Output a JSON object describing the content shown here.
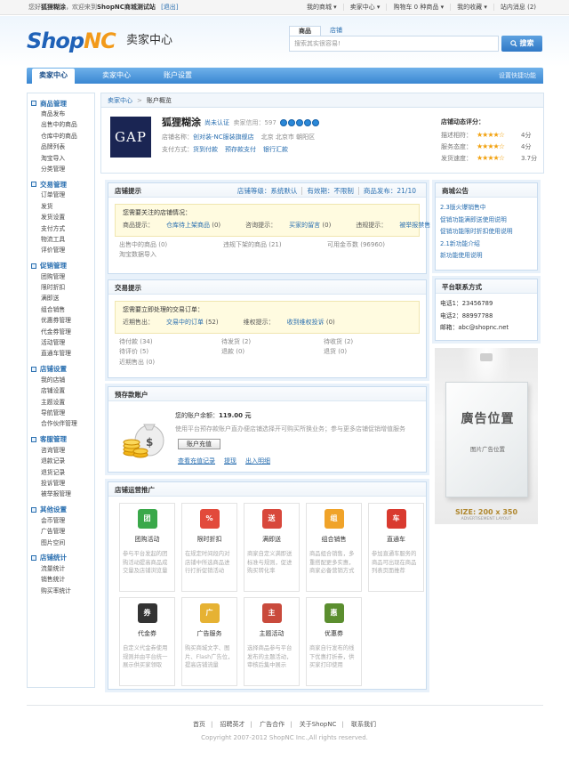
{
  "topbar": {
    "welcome_prefix": "您好",
    "user": "狐狸糊涂",
    "welcome_mid": "，欢迎来到",
    "site": "ShopNC商城测试站",
    "logout": "[退出]",
    "nav": [
      "我的商城 ▾",
      "卖家中心 ▾",
      "购物车 0 种商品 ▾",
      "我的收藏 ▾",
      "站内消息 (2)"
    ]
  },
  "header": {
    "logo_a": "Shop",
    "logo_b": "NC",
    "title": "卖家中心",
    "search_tabs": [
      "商品",
      "店铺"
    ],
    "search_placeholder": "搜索其实很容易!",
    "search_button": "搜索"
  },
  "mainnav": {
    "items": [
      "卖家中心",
      "卖家中心",
      "账户设置"
    ],
    "quick": "设置快捷功能"
  },
  "sidebar": [
    {
      "title": "商品管理",
      "items": [
        "商品发布",
        "出售中的商品",
        "仓库中的商品",
        "品牌列表",
        "淘宝导入",
        "分类管理"
      ]
    },
    {
      "title": "交易管理",
      "items": [
        "订单管理",
        "发货",
        "发货设置",
        "支付方式",
        "物流工具",
        "评价管理"
      ]
    },
    {
      "title": "促销管理",
      "items": [
        "团购管理",
        "限时折扣",
        "满即送",
        "组合销售",
        "优惠券管理",
        "代金券管理",
        "活动管理",
        "直通车管理"
      ]
    },
    {
      "title": "店铺设置",
      "items": [
        "我的店铺",
        "店铺设置",
        "主题设置",
        "导航管理",
        "合作伙伴管理"
      ]
    },
    {
      "title": "客服管理",
      "items": [
        "咨询管理",
        "退款记录",
        "退货记录",
        "投诉管理",
        "被举报管理"
      ]
    },
    {
      "title": "其他设置",
      "items": [
        "会币管理",
        "广告管理",
        "图片空间"
      ]
    },
    {
      "title": "店铺统计",
      "items": [
        "流量统计",
        "销售统计",
        "购买率统计"
      ]
    }
  ],
  "breadcrumb": {
    "root": "卖家中心",
    "sep": ">",
    "current": "账户概览"
  },
  "shop": {
    "logo": "GAP",
    "name": "狐狸糊涂",
    "cert": "尚未认证",
    "credit": "卖家信用：597",
    "line1_label": "店铺名称：",
    "line1_link": "创对装-NC服装旗舰店",
    "line1_loc": "北京 北京市 朝阳区",
    "line2_label": "支付方式：",
    "pay": [
      "货到付款",
      "预存款支付",
      "银行汇款"
    ],
    "dynamic_title": "店铺动态评分：",
    "ratings": [
      {
        "label": "描述相符：",
        "stars": 4,
        "score": "4分"
      },
      {
        "label": "服务态度：",
        "stars": 4,
        "score": "4分"
      },
      {
        "label": "发货速度：",
        "stars": 4,
        "score": "3.7分"
      }
    ]
  },
  "shop_notice": {
    "title": "店铺提示",
    "meta": [
      "店铺等级：系统默认",
      "有效期：不限制",
      "商品发布：21/10"
    ],
    "alert_title": "您需要关注的店铺情况：",
    "alerts": [
      {
        "label": "商品提示：",
        "link": "仓库待上架商品",
        "count": "(0)"
      },
      {
        "label": "咨询提示：",
        "link": "买家的留言",
        "count": "(0)"
      },
      {
        "label": "违规提示：",
        "link": "被举报禁售",
        "count": "(0)"
      }
    ],
    "stats": [
      [
        "出售中的商品 (0)",
        "违规下架的商品 (21)",
        "可用金币数 (96960)"
      ],
      [
        "淘宝数据导入",
        "",
        ""
      ]
    ]
  },
  "trade_notice": {
    "title": "交易提示",
    "alert_title": "您需要立即处理的交易订单：",
    "alerts": [
      {
        "label": "近期售出：",
        "link": "交易中的订单",
        "count": "(52)"
      },
      {
        "label": "维权提示：",
        "link": "收到维权投诉",
        "count": "(0)"
      }
    ],
    "stats": [
      [
        "待付款 (34)",
        "待发货 (2)",
        "待收货 (2)"
      ],
      [
        "待评价 (5)",
        "退款 (0)",
        "退货 (0)"
      ],
      [
        "近期售出 (0)",
        "",
        ""
      ]
    ]
  },
  "deposit": {
    "title": "预存款账户",
    "balance_label": "您的账户余额：",
    "balance": "119.00 元",
    "desc": "使用平台预存款账户直办便店铺选择开可购买所换业务；参与更多店铺促销增值服务",
    "button": "账户充值",
    "links": [
      "查看充值记录",
      "提现",
      "出入明细"
    ]
  },
  "promo": {
    "title": "店铺运营推广",
    "items": [
      {
        "name": "团购活动",
        "icon": "group-buy-icon",
        "color": "#3aa84a",
        "glyph": "团",
        "desc": "参与平台发起的团购活动提高商品成交量及店铺浏览量"
      },
      {
        "name": "限时折扣",
        "icon": "discount-icon",
        "color": "#e24a3b",
        "glyph": "%",
        "desc": "在规定时间段内对店铺中所选商品进行打折促销活动"
      },
      {
        "name": "满即送",
        "icon": "gift-cart-icon",
        "color": "#d8483c",
        "glyph": "送",
        "desc": "商家自定义满即送标准与规则，促进购买转化率"
      },
      {
        "name": "组合销售",
        "icon": "combo-sale-icon",
        "color": "#f0a329",
        "glyph": "组",
        "desc": "商品组合销售，多重搭配更多实惠，商家必备营销方式"
      },
      {
        "name": "直通车",
        "icon": "truck-icon",
        "color": "#d93a2f",
        "glyph": "车",
        "desc": "参加直通车服务的商品可出现在商品列表页面推荐"
      },
      {
        "name": "代金券",
        "icon": "voucher-icon",
        "color": "#333333",
        "glyph": "券",
        "desc": "自定义代金券使用规则并由平台统一展示供买家领取"
      },
      {
        "name": "广告服务",
        "icon": "handshake-icon",
        "color": "#e6b233",
        "glyph": "广",
        "desc": "购买商城文字、图片、Flash广告位，提高店铺流量"
      },
      {
        "name": "主题活动",
        "icon": "theme-icon",
        "color": "#c94a3c",
        "glyph": "主",
        "desc": "选择商品参与平台发布的主题活动，审核后集中展示"
      },
      {
        "name": "优惠券",
        "icon": "scissors-icon",
        "color": "#5b8e2f",
        "glyph": "惠",
        "desc": "商家自行发布的线下优惠打折券，供买家打印使用"
      }
    ]
  },
  "announcements": {
    "title": "商城公告",
    "items": [
      "2.3版火爆销售中",
      "促销功能满即送使用说明",
      "促销功能限时折扣使用说明",
      "2.1新功能介绍",
      "新功能使用说明"
    ]
  },
  "contact": {
    "title": "平台联系方式",
    "items": [
      "电话1：23456789",
      "电话2：88997788",
      "邮箱：abc@shopnc.net"
    ]
  },
  "ad": {
    "big": "廣告位置",
    "small": "图片广告位置",
    "size": "SIZE: 200 x 350",
    "sub": "ADVERTISEMENT LAYOUT"
  },
  "footer": {
    "links": [
      "首页",
      "招聘英才",
      "广告合作",
      "关于ShopNC",
      "联系我们"
    ],
    "copy": "Copyright 2007-2012 ShopNC Inc.,All rights reserved."
  }
}
